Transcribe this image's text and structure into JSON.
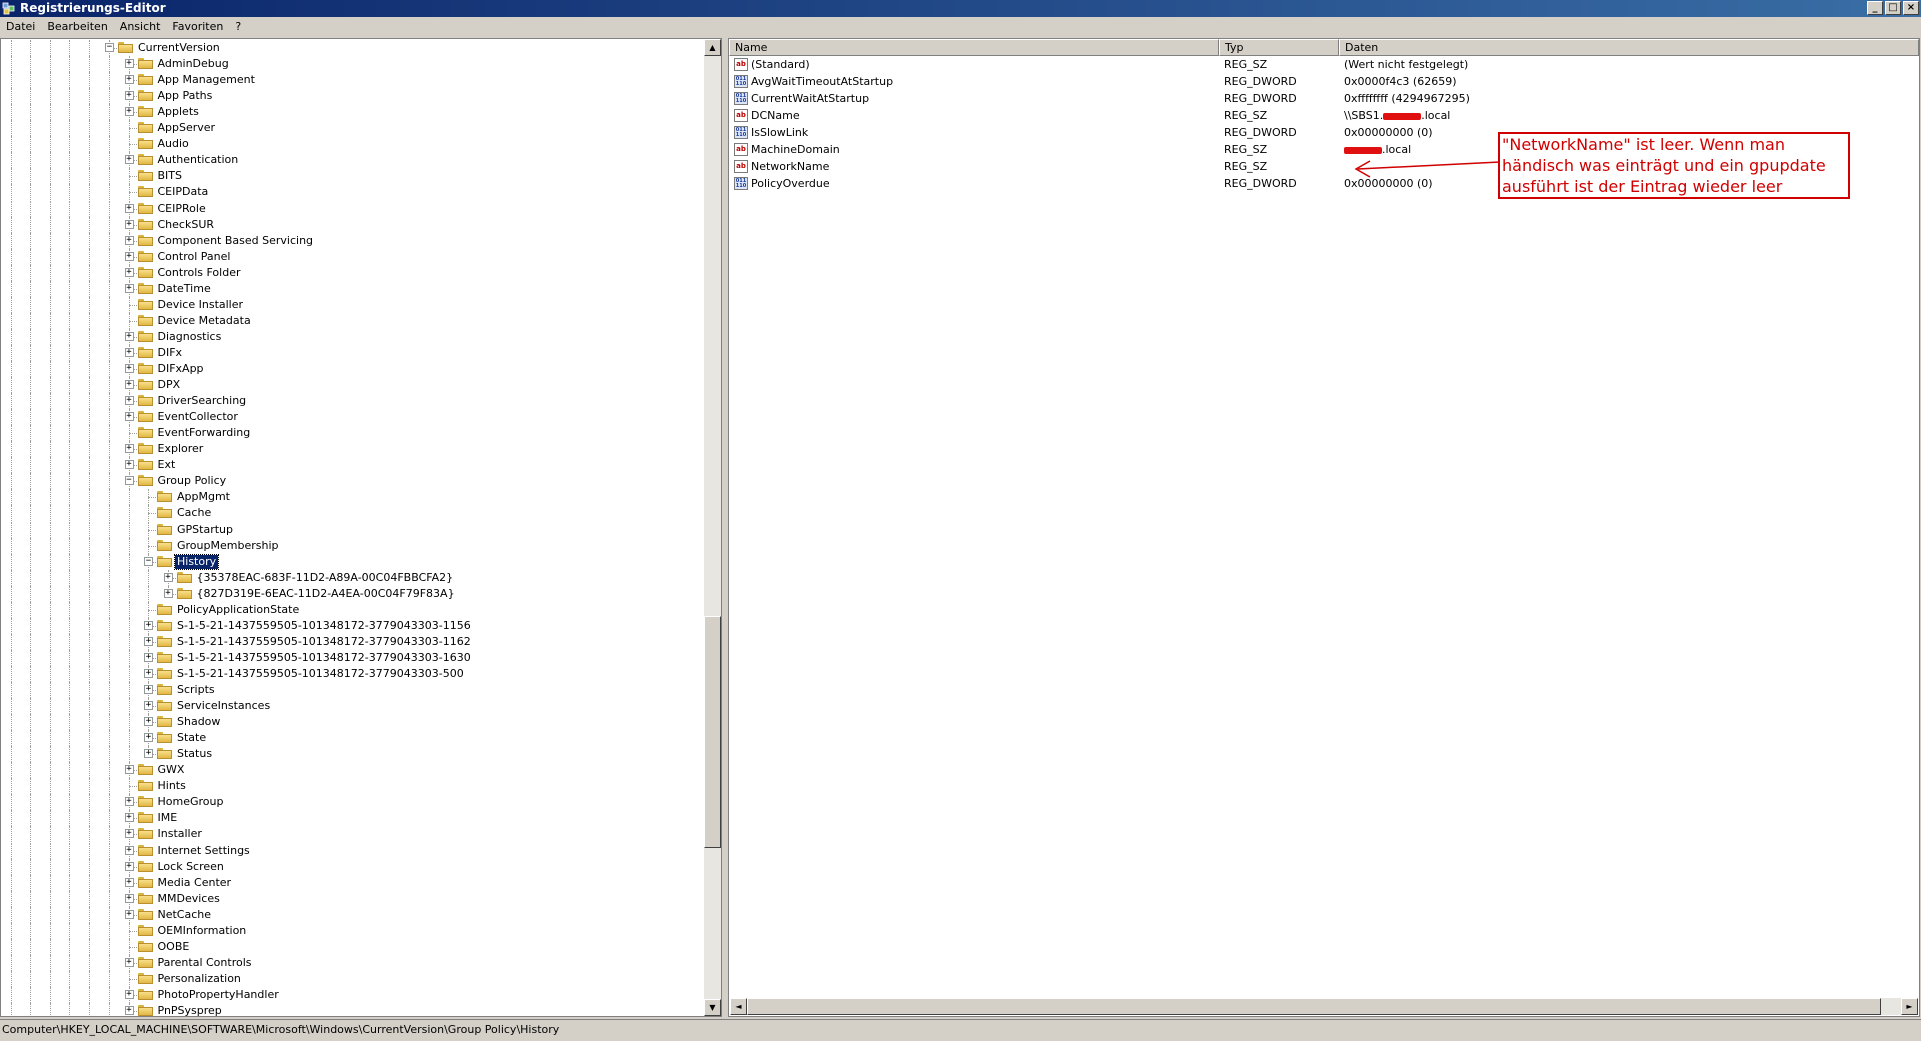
{
  "window": {
    "title": "Registrierungs-Editor",
    "buttons": {
      "minimize": "_",
      "maximize": "□",
      "close": "×"
    }
  },
  "menu": [
    "Datei",
    "Bearbeiten",
    "Ansicht",
    "Favoriten",
    "?"
  ],
  "tree": {
    "items": [
      {
        "label": "CurrentVersion",
        "level": 0,
        "state": "open"
      },
      {
        "label": "AdminDebug",
        "level": 1,
        "state": "closed"
      },
      {
        "label": "App Management",
        "level": 1,
        "state": "closed"
      },
      {
        "label": "App Paths",
        "level": 1,
        "state": "closed"
      },
      {
        "label": "Applets",
        "level": 1,
        "state": "closed"
      },
      {
        "label": "AppServer",
        "level": 1,
        "state": "leaf"
      },
      {
        "label": "Audio",
        "level": 1,
        "state": "leaf"
      },
      {
        "label": "Authentication",
        "level": 1,
        "state": "closed"
      },
      {
        "label": "BITS",
        "level": 1,
        "state": "leaf"
      },
      {
        "label": "CEIPData",
        "level": 1,
        "state": "leaf"
      },
      {
        "label": "CEIPRole",
        "level": 1,
        "state": "closed"
      },
      {
        "label": "CheckSUR",
        "level": 1,
        "state": "closed"
      },
      {
        "label": "Component Based Servicing",
        "level": 1,
        "state": "closed"
      },
      {
        "label": "Control Panel",
        "level": 1,
        "state": "closed"
      },
      {
        "label": "Controls Folder",
        "level": 1,
        "state": "closed"
      },
      {
        "label": "DateTime",
        "level": 1,
        "state": "closed"
      },
      {
        "label": "Device Installer",
        "level": 1,
        "state": "leaf"
      },
      {
        "label": "Device Metadata",
        "level": 1,
        "state": "leaf"
      },
      {
        "label": "Diagnostics",
        "level": 1,
        "state": "closed"
      },
      {
        "label": "DIFx",
        "level": 1,
        "state": "closed"
      },
      {
        "label": "DIFxApp",
        "level": 1,
        "state": "closed"
      },
      {
        "label": "DPX",
        "level": 1,
        "state": "closed"
      },
      {
        "label": "DriverSearching",
        "level": 1,
        "state": "closed"
      },
      {
        "label": "EventCollector",
        "level": 1,
        "state": "closed"
      },
      {
        "label": "EventForwarding",
        "level": 1,
        "state": "leaf"
      },
      {
        "label": "Explorer",
        "level": 1,
        "state": "closed"
      },
      {
        "label": "Ext",
        "level": 1,
        "state": "closed"
      },
      {
        "label": "Group Policy",
        "level": 1,
        "state": "open"
      },
      {
        "label": "AppMgmt",
        "level": 2,
        "state": "leaf"
      },
      {
        "label": "Cache",
        "level": 2,
        "state": "leaf"
      },
      {
        "label": "GPStartup",
        "level": 2,
        "state": "leaf"
      },
      {
        "label": "GroupMembership",
        "level": 2,
        "state": "leaf"
      },
      {
        "label": "History",
        "level": 2,
        "state": "open",
        "selected": true
      },
      {
        "label": "{35378EAC-683F-11D2-A89A-00C04FBBCFA2}",
        "level": 3,
        "state": "closed"
      },
      {
        "label": "{827D319E-6EAC-11D2-A4EA-00C04F79F83A}",
        "level": 3,
        "state": "closed"
      },
      {
        "label": "PolicyApplicationState",
        "level": 2,
        "state": "leaf"
      },
      {
        "label": "S-1-5-21-1437559505-101348172-3779043303-1156",
        "level": 2,
        "state": "closed"
      },
      {
        "label": "S-1-5-21-1437559505-101348172-3779043303-1162",
        "level": 2,
        "state": "closed"
      },
      {
        "label": "S-1-5-21-1437559505-101348172-3779043303-1630",
        "level": 2,
        "state": "closed"
      },
      {
        "label": "S-1-5-21-1437559505-101348172-3779043303-500",
        "level": 2,
        "state": "closed"
      },
      {
        "label": "Scripts",
        "level": 2,
        "state": "closed"
      },
      {
        "label": "ServiceInstances",
        "level": 2,
        "state": "closed"
      },
      {
        "label": "Shadow",
        "level": 2,
        "state": "closed"
      },
      {
        "label": "State",
        "level": 2,
        "state": "closed"
      },
      {
        "label": "Status",
        "level": 2,
        "state": "closed"
      },
      {
        "label": "GWX",
        "level": 1,
        "state": "closed"
      },
      {
        "label": "Hints",
        "level": 1,
        "state": "leaf"
      },
      {
        "label": "HomeGroup",
        "level": 1,
        "state": "closed"
      },
      {
        "label": "IME",
        "level": 1,
        "state": "closed"
      },
      {
        "label": "Installer",
        "level": 1,
        "state": "closed"
      },
      {
        "label": "Internet Settings",
        "level": 1,
        "state": "closed"
      },
      {
        "label": "Lock Screen",
        "level": 1,
        "state": "closed"
      },
      {
        "label": "Media Center",
        "level": 1,
        "state": "closed"
      },
      {
        "label": "MMDevices",
        "level": 1,
        "state": "closed"
      },
      {
        "label": "NetCache",
        "level": 1,
        "state": "closed"
      },
      {
        "label": "OEMInformation",
        "level": 1,
        "state": "leaf"
      },
      {
        "label": "OOBE",
        "level": 1,
        "state": "leaf"
      },
      {
        "label": "Parental Controls",
        "level": 1,
        "state": "closed"
      },
      {
        "label": "Personalization",
        "level": 1,
        "state": "leaf"
      },
      {
        "label": "PhotoPropertyHandler",
        "level": 1,
        "state": "closed"
      },
      {
        "label": "PnPSysprep",
        "level": 1,
        "state": "closed"
      }
    ]
  },
  "list": {
    "columns": [
      "Name",
      "Typ",
      "Daten"
    ],
    "rows": [
      {
        "icon": "ab",
        "name": "(Standard)",
        "type": "REG_SZ",
        "data": "(Wert nicht festgelegt)"
      },
      {
        "icon": "dw",
        "name": "AvgWaitTimeoutAtStartup",
        "type": "REG_DWORD",
        "data": "0x0000f4c3 (62659)"
      },
      {
        "icon": "dw",
        "name": "CurrentWaitAtStartup",
        "type": "REG_DWORD",
        "data": "0xffffffff (4294967295)"
      },
      {
        "icon": "ab",
        "name": "DCName",
        "type": "REG_SZ",
        "data_prefix": "\\\\SBS1.",
        "data_suffix": ".local",
        "redacted": true
      },
      {
        "icon": "dw",
        "name": "IsSlowLink",
        "type": "REG_DWORD",
        "data": "0x00000000 (0)"
      },
      {
        "icon": "ab",
        "name": "MachineDomain",
        "type": "REG_SZ",
        "data_prefix": "",
        "data_suffix": ".local",
        "redacted": true
      },
      {
        "icon": "ab",
        "name": "NetworkName",
        "type": "REG_SZ",
        "data": ""
      },
      {
        "icon": "dw",
        "name": "PolicyOverdue",
        "type": "REG_DWORD",
        "data": "0x00000000 (0)"
      }
    ]
  },
  "annotation": {
    "text": "\"NetworkName\" ist leer. Wenn man händisch was einträgt und ein gpupdate ausführt ist der Eintrag wieder leer",
    "color": "#d00000"
  },
  "icons": {
    "string_value": "ab",
    "dword_value": "011\n110",
    "up": "▲",
    "down": "▼",
    "left": "◄",
    "right": "►"
  },
  "status": {
    "path": "Computer\\HKEY_LOCAL_MACHINE\\SOFTWARE\\Microsoft\\Windows\\CurrentVersion\\Group Policy\\History"
  }
}
